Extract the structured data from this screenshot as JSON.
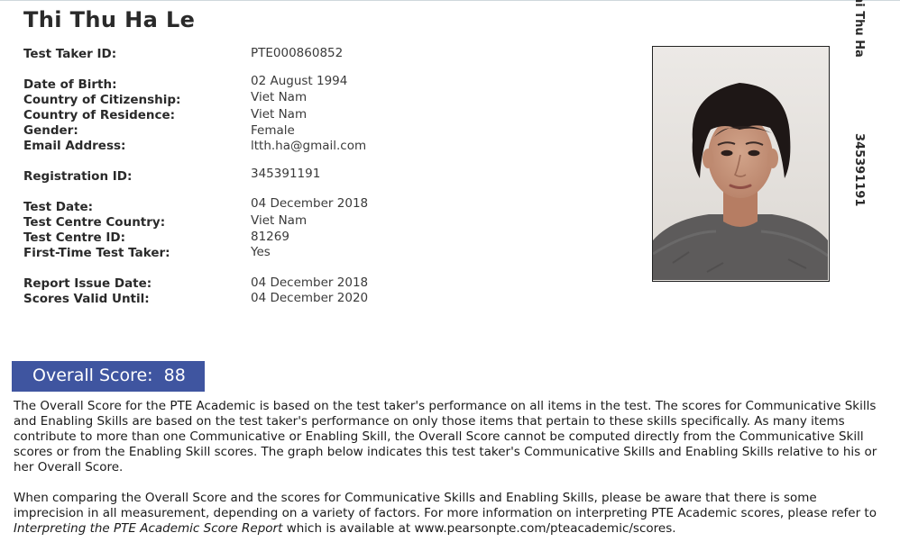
{
  "header": {
    "name": "Thi Thu Ha Le"
  },
  "fields": {
    "test_taker_id": {
      "label": "Test Taker ID:",
      "value": "PTE000860852"
    },
    "date_of_birth": {
      "label": "Date of Birth:",
      "value": "02 August 1994"
    },
    "country_of_citizenship": {
      "label": "Country of Citizenship:",
      "value": "Viet Nam"
    },
    "country_of_residence": {
      "label": "Country of Residence:",
      "value": "Viet Nam"
    },
    "gender": {
      "label": "Gender:",
      "value": "Female"
    },
    "email_address": {
      "label": "Email Address:",
      "value": "ltth.ha@gmail.com"
    },
    "registration_id": {
      "label": "Registration ID:",
      "value": "345391191"
    },
    "test_date": {
      "label": "Test Date:",
      "value": "04 December 2018"
    },
    "test_centre_country": {
      "label": "Test Centre Country:",
      "value": "Viet Nam"
    },
    "test_centre_id": {
      "label": "Test Centre ID:",
      "value": "81269"
    },
    "first_time_test_taker": {
      "label": "First-Time Test Taker:",
      "value": "Yes"
    },
    "report_issue_date": {
      "label": "Report Issue Date:",
      "value": "04 December 2018"
    },
    "scores_valid_until": {
      "label": "Scores Valid Until:",
      "value": "04 December 2020"
    }
  },
  "side": {
    "name": "hi Thu Ha",
    "id": "345391191"
  },
  "score": {
    "label": "Overall Score:",
    "value": "88"
  },
  "body": {
    "paragraph1": "The Overall Score for the PTE Academic is based on the test taker's performance on all items in the test.  The scores for Communicative Skills and Enabling Skills are based on the test taker's performance on only those items that pertain to these skills specifically.  As many items contribute to more than one Communicative or Enabling Skill, the Overall Score cannot be computed directly from the Communicative Skill scores or from the Enabling Skill scores.  The graph below indicates this test taker's Communicative Skills and Enabling Skills relative to his or her Overall Score.",
    "paragraph2_before": "When comparing the Overall Score and the scores for Communicative Skills and Enabling Skills, please be aware that there is some imprecision in all measurement, depending on a variety of factors.  For more information on interpreting PTE Academic scores, please refer to ",
    "paragraph2_title": "Interpreting the PTE Academic Score Report",
    "paragraph2_after": " which is available at www.pearsonpte.com/pteacademic/scores."
  },
  "colors": {
    "score_box": "#3f55a0",
    "text": "#1a1a1a"
  }
}
